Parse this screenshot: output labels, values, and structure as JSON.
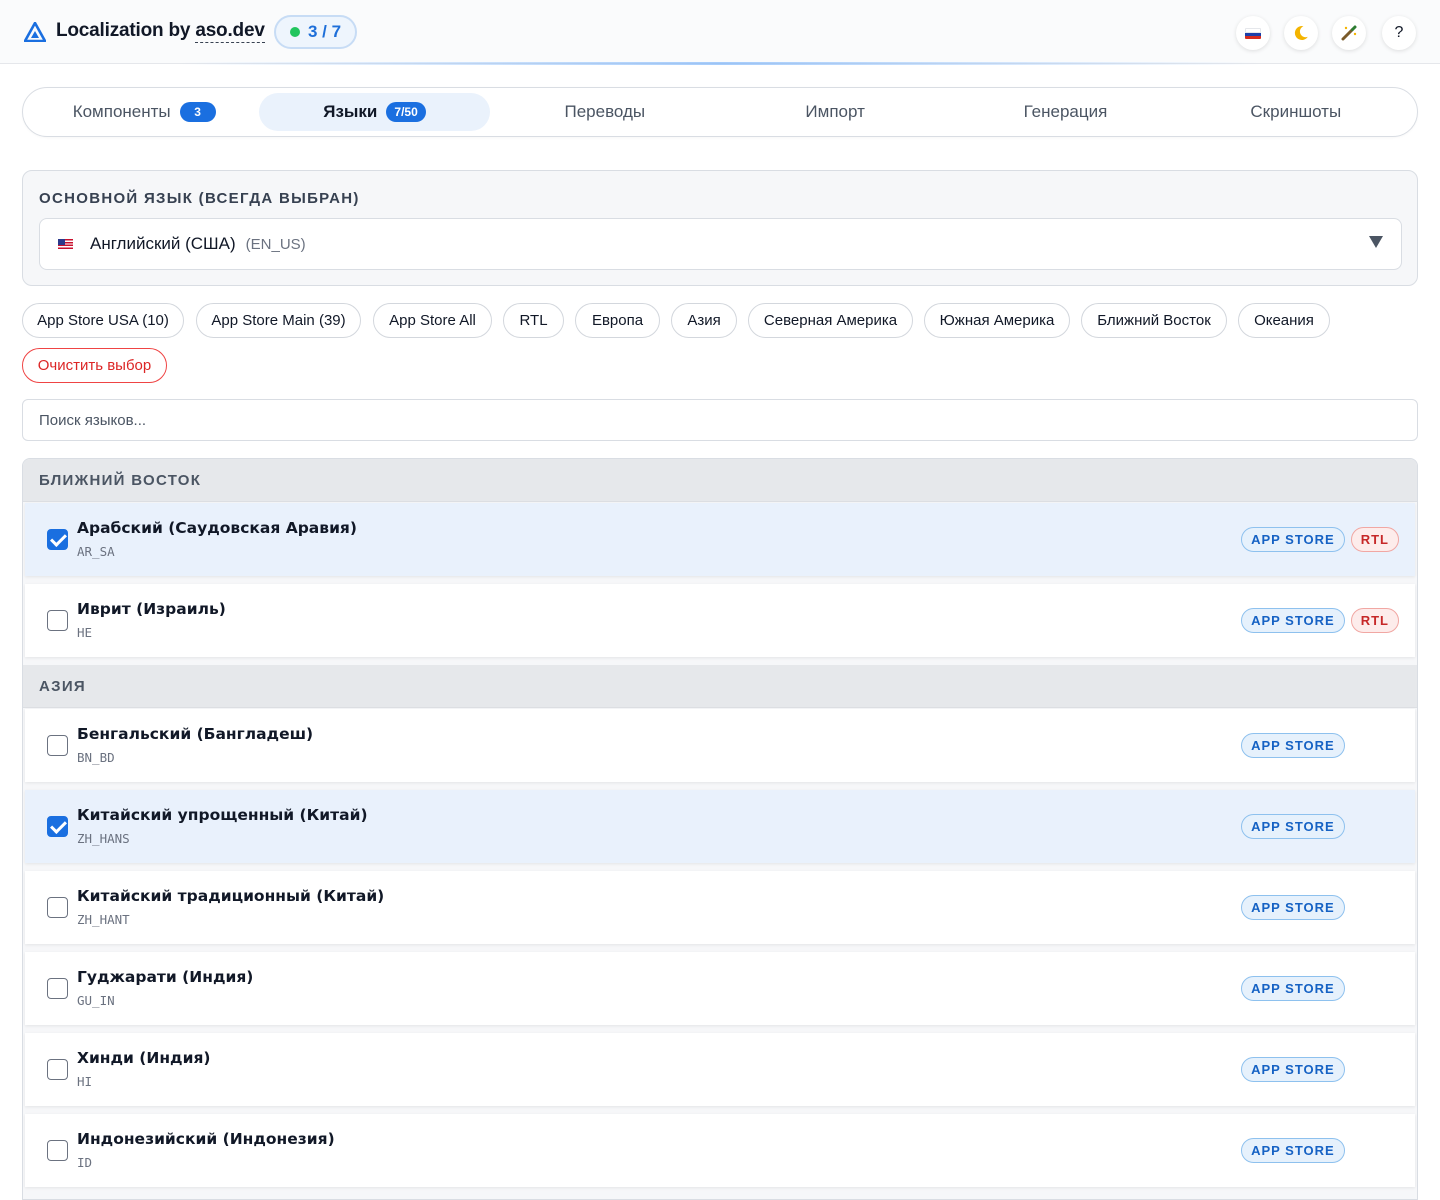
{
  "header": {
    "title_prefix": "Localization by ",
    "title_link": "aso.dev",
    "progress": "3 / 7",
    "help_label": "?"
  },
  "tabs": [
    {
      "label": "Компоненты",
      "badge": "3"
    },
    {
      "label": "Языки",
      "badge": "7/50"
    },
    {
      "label": "Переводы"
    },
    {
      "label": "Импорт"
    },
    {
      "label": "Генерация"
    },
    {
      "label": "Скриншоты"
    }
  ],
  "primary_language": {
    "label": "ОСНОВНОЙ ЯЗЫК (ВСЕГДА ВЫБРАН)",
    "name": "Английский (США)",
    "code": "(EN_US)"
  },
  "presets": [
    "App Store USA (10)",
    "App Store Main (39)",
    "App Store All",
    "RTL",
    "Европа",
    "Азия",
    "Северная Америка",
    "Южная Америка",
    "Ближний Восток",
    "Океания"
  ],
  "clear_label": "Очистить выбор",
  "search": {
    "placeholder": "Поиск языков...",
    "value": ""
  },
  "groups": [
    {
      "title": "БЛИЖНИЙ ВОСТОК",
      "languages": [
        {
          "name": "Арабский (Саудовская Аравия)",
          "code": "AR_SA",
          "checked": true,
          "tags": [
            "APP STORE",
            "RTL"
          ]
        },
        {
          "name": "Иврит (Израиль)",
          "code": "HE",
          "checked": false,
          "tags": [
            "APP STORE",
            "RTL"
          ]
        }
      ]
    },
    {
      "title": "АЗИЯ",
      "languages": [
        {
          "name": "Бенгальский (Бангладеш)",
          "code": "BN_BD",
          "checked": false,
          "tags": [
            "APP STORE"
          ]
        },
        {
          "name": "Китайский упрощенный (Китай)",
          "code": "ZH_HANS",
          "checked": true,
          "tags": [
            "APP STORE"
          ]
        },
        {
          "name": "Китайский традиционный (Китай)",
          "code": "ZH_HANT",
          "checked": false,
          "tags": [
            "APP STORE"
          ]
        },
        {
          "name": "Гуджарати (Индия)",
          "code": "GU_IN",
          "checked": false,
          "tags": [
            "APP STORE"
          ]
        },
        {
          "name": "Хинди (Индия)",
          "code": "HI",
          "checked": false,
          "tags": [
            "APP STORE"
          ]
        },
        {
          "name": "Индонезийский (Индонезия)",
          "code": "ID",
          "checked": false,
          "tags": [
            "APP STORE"
          ]
        }
      ]
    }
  ],
  "colors": {
    "accent": "#1a6fe0",
    "status_dot": "#22c55e",
    "rtl": "#c62828",
    "clear": "#dc2626"
  }
}
